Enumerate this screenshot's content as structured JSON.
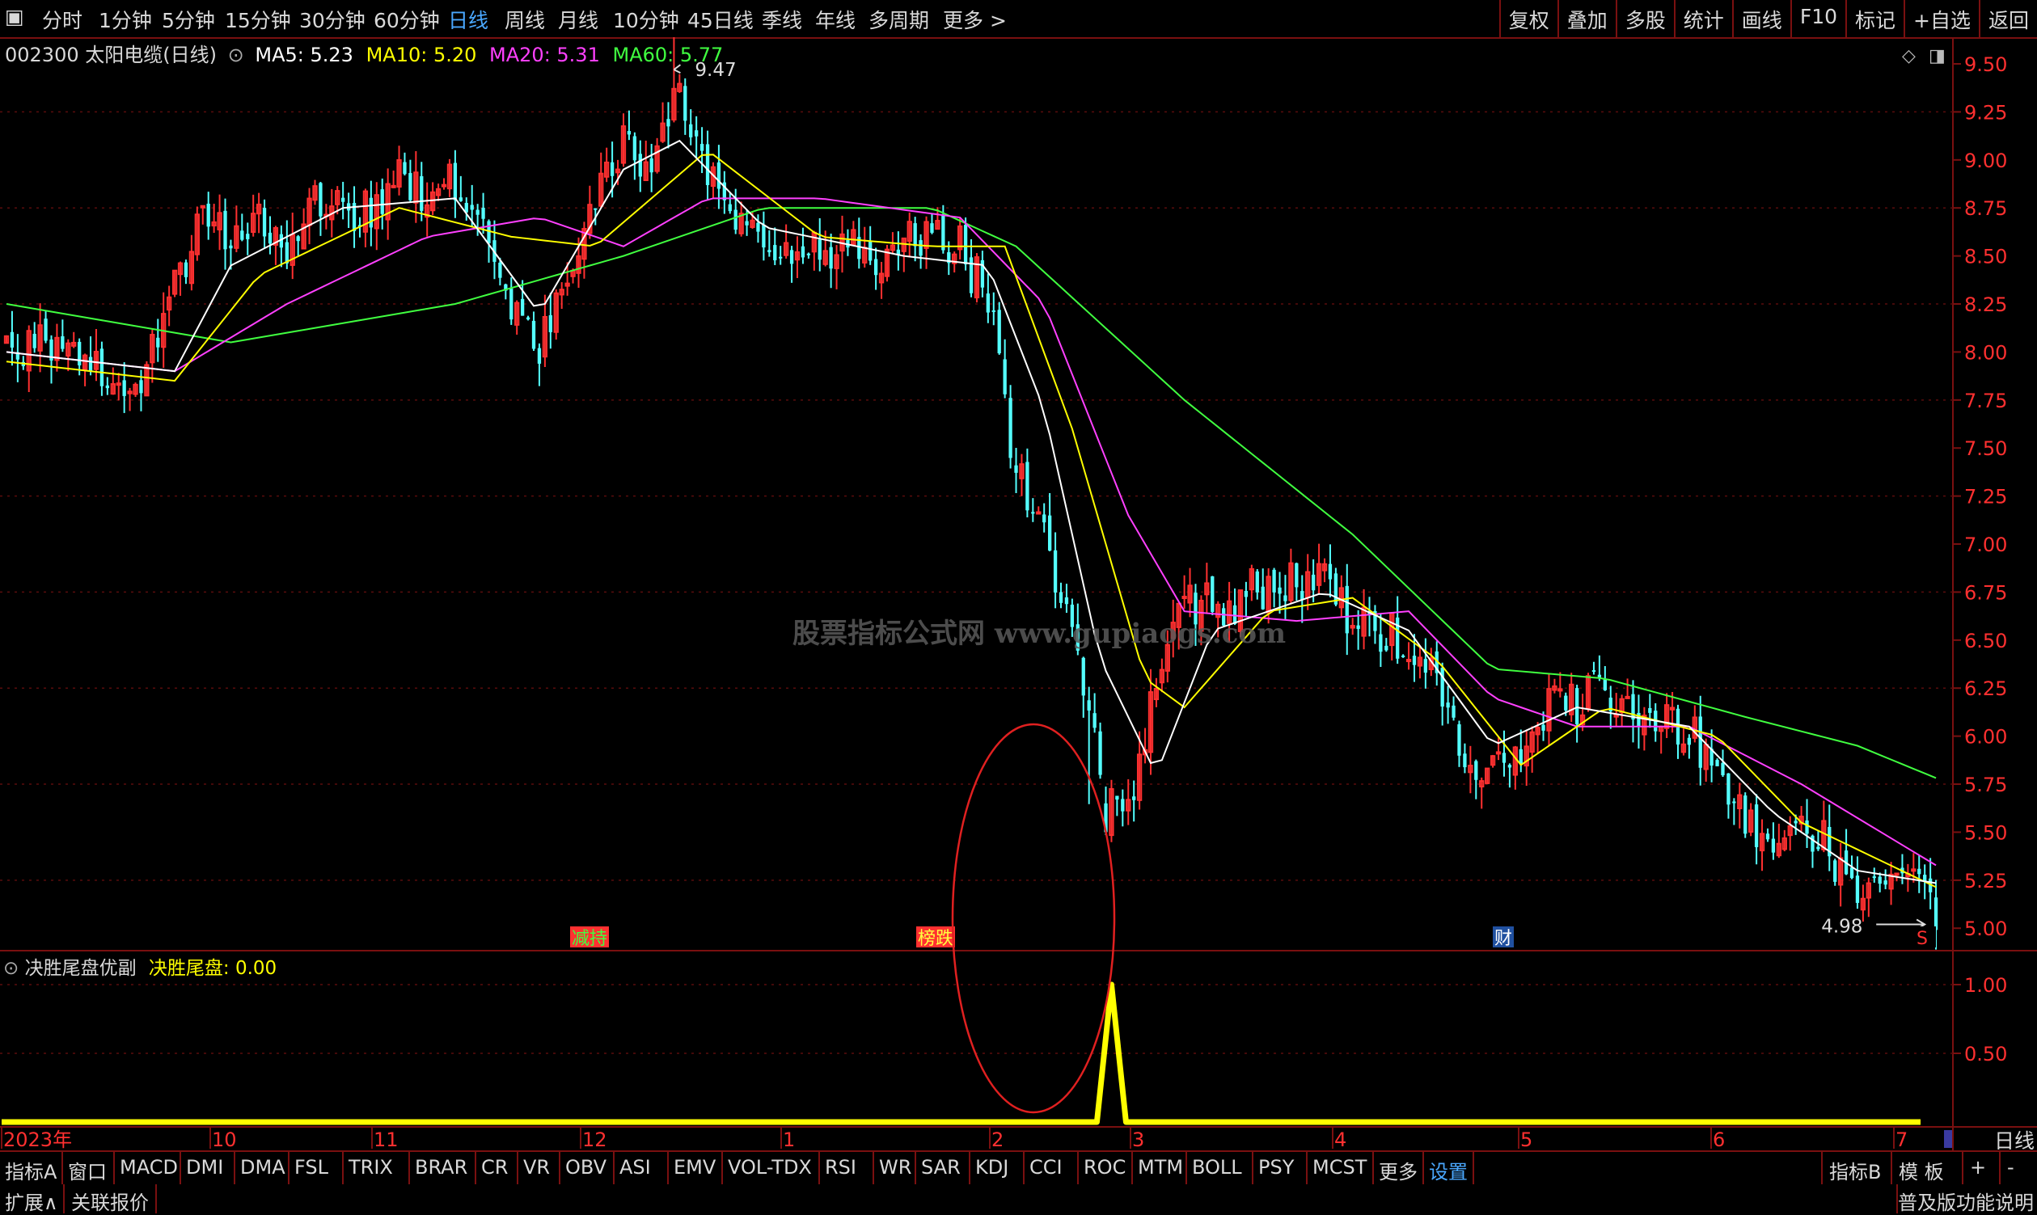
{
  "toolbar": {
    "left_items": [
      "分时",
      "1分钟",
      "5分钟",
      "15分钟",
      "30分钟",
      "60分钟",
      "日线",
      "周线",
      "月线",
      "10分钟",
      "45日线",
      "季线",
      "年线",
      "多周期",
      "更多 >"
    ],
    "active": "日线",
    "right_items": [
      "复权",
      "叠加",
      "多股",
      "统计",
      "画线",
      "F10",
      "标记",
      "+自选",
      "返回"
    ]
  },
  "stock": {
    "code_name": "002300 太阳电缆(日线)",
    "ma5": "MA5: 5.23",
    "ma10": "MA10: 5.20",
    "ma20": "MA20: 5.31",
    "ma60": "MA60: 5.77"
  },
  "indicator": {
    "name": "决胜尾盘优副",
    "label": "决胜尾盘: 0.00"
  },
  "watermark": "股票指标公式网 www.gupiaogs.com",
  "annotations": {
    "high": "9.47",
    "low": "4.98",
    "tag1": "减持",
    "tag2": "榜跌",
    "tag3": "财",
    "tag4": "S"
  },
  "chart_data": {
    "type": "candlestick",
    "price_axis": [
      "9.50",
      "9.25",
      "9.00",
      "8.75",
      "8.50",
      "8.25",
      "8.00",
      "7.75",
      "7.50",
      "7.25",
      "7.00",
      "6.75",
      "6.50",
      "6.25",
      "6.00",
      "5.75",
      "5.50",
      "5.25",
      "5.00"
    ],
    "ylim": [
      4.9,
      9.58
    ],
    "indicator_axis": [
      "1.00",
      "0.50"
    ],
    "x_labels": [
      "2023年",
      "10",
      "11",
      "12",
      "1",
      "2",
      "3",
      "4",
      "5",
      "6",
      "7"
    ],
    "period_label": "日线",
    "close_path": [
      [
        0,
        8.02
      ],
      [
        5,
        7.98
      ],
      [
        10,
        8.05
      ],
      [
        15,
        7.95
      ],
      [
        20,
        7.82
      ],
      [
        25,
        7.88
      ],
      [
        30,
        8.35
      ],
      [
        35,
        8.7
      ],
      [
        40,
        8.58
      ],
      [
        45,
        8.72
      ],
      [
        50,
        8.55
      ],
      [
        55,
        8.8
      ],
      [
        60,
        8.82
      ],
      [
        65,
        8.7
      ],
      [
        70,
        8.98
      ],
      [
        75,
        8.8
      ],
      [
        80,
        8.88
      ],
      [
        85,
        8.62
      ],
      [
        90,
        8.3
      ],
      [
        95,
        8.05
      ],
      [
        100,
        8.4
      ],
      [
        105,
        8.8
      ],
      [
        110,
        9.05
      ],
      [
        115,
        8.9
      ],
      [
        120,
        9.35
      ],
      [
        125,
        8.95
      ],
      [
        130,
        8.72
      ],
      [
        135,
        8.6
      ],
      [
        140,
        8.5
      ],
      [
        145,
        8.55
      ],
      [
        150,
        8.6
      ],
      [
        155,
        8.35
      ],
      [
        160,
        8.55
      ],
      [
        165,
        8.7
      ],
      [
        170,
        8.52
      ],
      [
        175,
        8.3
      ],
      [
        180,
        7.4
      ],
      [
        185,
        7.05
      ],
      [
        190,
        6.55
      ],
      [
        195,
        5.85
      ],
      [
        200,
        5.55
      ],
      [
        205,
        6.3
      ],
      [
        210,
        6.7
      ],
      [
        215,
        6.65
      ],
      [
        220,
        6.72
      ],
      [
        225,
        6.78
      ],
      [
        230,
        6.8
      ],
      [
        235,
        6.8
      ],
      [
        240,
        6.6
      ],
      [
        245,
        6.55
      ],
      [
        250,
        6.4
      ],
      [
        255,
        6.35
      ],
      [
        260,
        5.85
      ],
      [
        265,
        5.85
      ],
      [
        270,
        5.9
      ],
      [
        275,
        6.18
      ],
      [
        280,
        6.2
      ],
      [
        285,
        6.2
      ],
      [
        290,
        6.1
      ],
      [
        295,
        6.1
      ],
      [
        300,
        6.05
      ],
      [
        305,
        5.85
      ],
      [
        310,
        5.55
      ],
      [
        315,
        5.42
      ],
      [
        320,
        5.5
      ],
      [
        325,
        5.4
      ],
      [
        330,
        5.18
      ],
      [
        335,
        5.25
      ],
      [
        340,
        5.3
      ],
      [
        345,
        5.02
      ]
    ],
    "ma5": [
      [
        0,
        8.0
      ],
      [
        30,
        7.9
      ],
      [
        40,
        8.45
      ],
      [
        60,
        8.75
      ],
      [
        80,
        8.8
      ],
      [
        95,
        8.2
      ],
      [
        110,
        8.95
      ],
      [
        120,
        9.1
      ],
      [
        135,
        8.65
      ],
      [
        160,
        8.5
      ],
      [
        175,
        8.45
      ],
      [
        185,
        7.7
      ],
      [
        195,
        6.4
      ],
      [
        205,
        5.8
      ],
      [
        215,
        6.55
      ],
      [
        235,
        6.75
      ],
      [
        250,
        6.55
      ],
      [
        265,
        5.95
      ],
      [
        280,
        6.15
      ],
      [
        300,
        6.05
      ],
      [
        315,
        5.6
      ],
      [
        330,
        5.3
      ],
      [
        345,
        5.23
      ]
    ],
    "ma10": [
      [
        0,
        7.95
      ],
      [
        30,
        7.85
      ],
      [
        45,
        8.4
      ],
      [
        70,
        8.75
      ],
      [
        90,
        8.6
      ],
      [
        105,
        8.55
      ],
      [
        125,
        9.05
      ],
      [
        145,
        8.6
      ],
      [
        165,
        8.55
      ],
      [
        178,
        8.55
      ],
      [
        190,
        7.6
      ],
      [
        203,
        6.3
      ],
      [
        210,
        6.15
      ],
      [
        225,
        6.65
      ],
      [
        240,
        6.72
      ],
      [
        255,
        6.4
      ],
      [
        270,
        5.85
      ],
      [
        285,
        6.15
      ],
      [
        305,
        6.0
      ],
      [
        320,
        5.55
      ],
      [
        345,
        5.2
      ]
    ],
    "ma20": [
      [
        0,
        8.0
      ],
      [
        30,
        7.9
      ],
      [
        50,
        8.25
      ],
      [
        75,
        8.6
      ],
      [
        95,
        8.7
      ],
      [
        110,
        8.55
      ],
      [
        125,
        8.8
      ],
      [
        145,
        8.8
      ],
      [
        170,
        8.7
      ],
      [
        185,
        8.25
      ],
      [
        200,
        7.15
      ],
      [
        210,
        6.65
      ],
      [
        230,
        6.6
      ],
      [
        250,
        6.65
      ],
      [
        265,
        6.2
      ],
      [
        280,
        6.05
      ],
      [
        300,
        6.05
      ],
      [
        320,
        5.75
      ],
      [
        345,
        5.31
      ]
    ],
    "ma60": [
      [
        0,
        8.25
      ],
      [
        40,
        8.05
      ],
      [
        80,
        8.25
      ],
      [
        110,
        8.5
      ],
      [
        135,
        8.75
      ],
      [
        165,
        8.75
      ],
      [
        180,
        8.55
      ],
      [
        210,
        7.75
      ],
      [
        240,
        7.05
      ],
      [
        265,
        6.35
      ],
      [
        285,
        6.3
      ],
      [
        310,
        6.1
      ],
      [
        330,
        5.95
      ],
      [
        345,
        5.77
      ]
    ],
    "signal": {
      "position": 197,
      "value": 1.0
    },
    "n_bars": 345
  },
  "bottom_tabs": [
    "指标A",
    "窗口",
    "MACD",
    "DMI",
    "DMA",
    "FSL",
    "TRIX",
    "BRAR",
    "CR",
    "VR",
    "OBV",
    "ASI",
    "EMV",
    "VOL-TDX",
    "RSI",
    "WR",
    "SAR",
    "KDJ",
    "CCI",
    "ROC",
    "MTM",
    "BOLL",
    "PSY",
    "MCST",
    "更多",
    "设置"
  ],
  "bottom_active": "设置",
  "bottom_right": [
    "指标B",
    "模 板",
    "+",
    "-"
  ],
  "status_left": [
    "扩展∧",
    "关联报价"
  ],
  "status_right": "普及版功能说明",
  "colors": {
    "up": "#ff3030",
    "down": "#54ffff",
    "ma5": "#ffffff",
    "ma10": "#ffff00",
    "ma20": "#ff40ff",
    "ma60": "#40ff40",
    "grid": "#7a1010"
  }
}
